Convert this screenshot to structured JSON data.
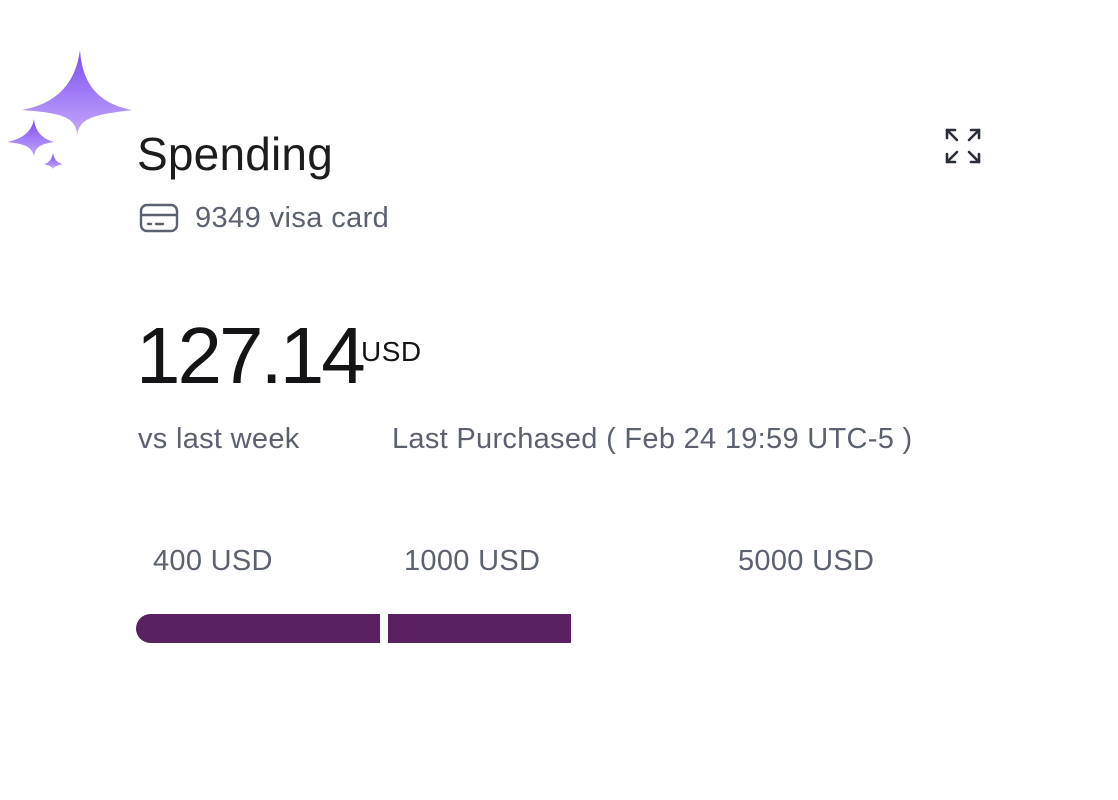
{
  "widget": {
    "title": "Spending",
    "card_label": "9349 visa card",
    "amount": "127.14",
    "currency": "USD",
    "comparison": "vs last week",
    "last_purchased": "Last Purchased ( Feb 24 19:59 UTC-5 )"
  },
  "icons": {
    "sparkle": "sparkle-icon",
    "card": "credit-card-icon",
    "expand": "expand-icon"
  },
  "progress": {
    "thresholds": [
      "400 USD",
      "1000 USD",
      "5000 USD"
    ],
    "segments_filled": 2,
    "bar_color": "#5a2162"
  },
  "colors": {
    "sparkle": "#9b6cf6",
    "text_primary": "#141416",
    "text_secondary": "#5b616e"
  }
}
